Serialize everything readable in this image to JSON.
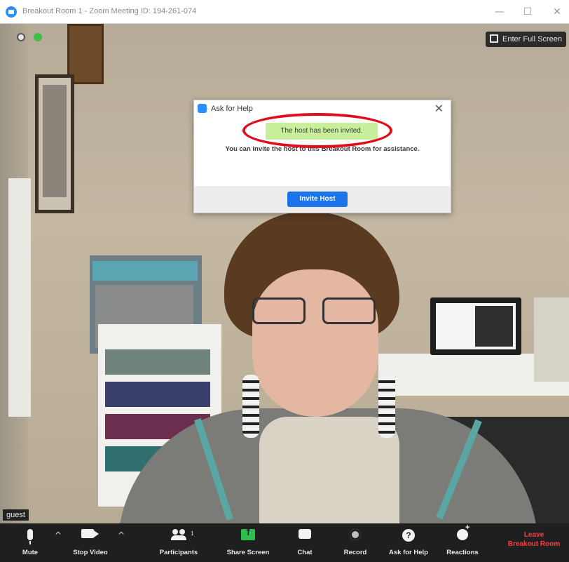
{
  "window": {
    "title": "Breakout Room 1 - Zoom Meeting ID: 194-261-074",
    "minimize_glyph": "—",
    "maximize_glyph": "☐",
    "close_glyph": "✕"
  },
  "video": {
    "fullscreen_label": "Enter Full Screen",
    "participant_name": "guest"
  },
  "dialog": {
    "title": "Ask for Help",
    "close_glyph": "✕",
    "success_message": "The host has been invited.",
    "message": "You can invite the host to this Breakout Room for assistance.",
    "button_label": "Invite Host",
    "highlight_color": "#e00d1c"
  },
  "toolbar": {
    "mute_label": "Mute",
    "stop_video_label": "Stop Video",
    "participants_label": "Participants",
    "participants_count": "1",
    "share_label": "Share Screen",
    "chat_label": "Chat",
    "record_label": "Record",
    "ask_help_label": "Ask for Help",
    "help_glyph": "?",
    "reactions_label": "Reactions",
    "leave_line1": "Leave",
    "leave_line2": "Breakout Room",
    "caret_glyph": "^"
  },
  "colors": {
    "accent": "#2d8cff",
    "share_green": "#2fc04b",
    "leave_red": "#ff3b3b"
  }
}
